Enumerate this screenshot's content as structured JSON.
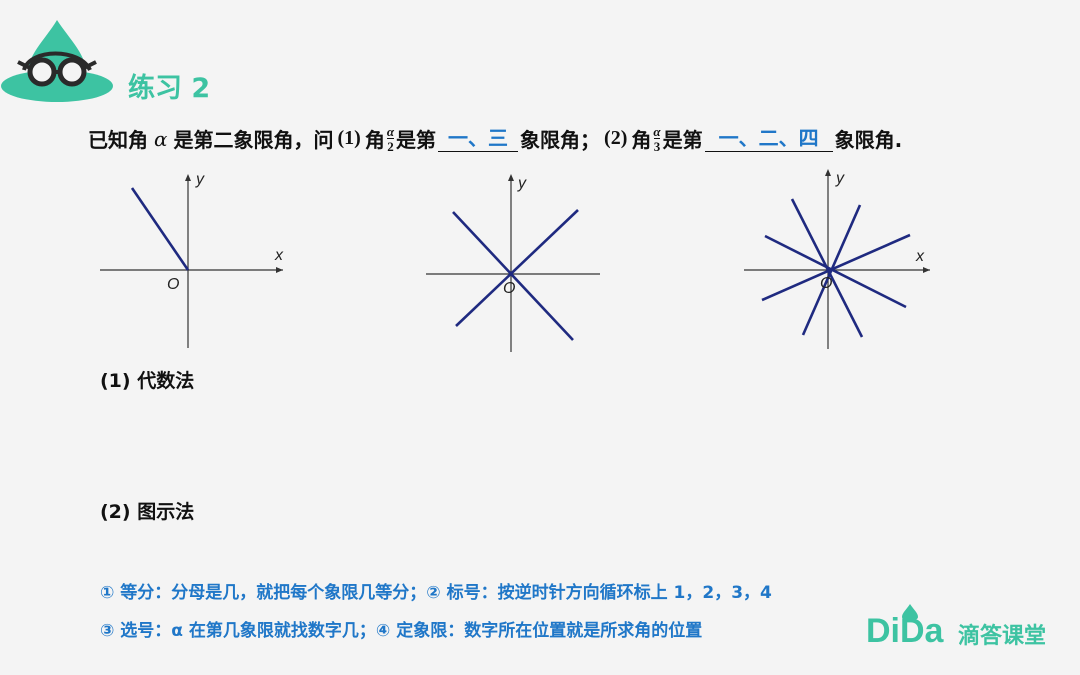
{
  "title": "练习 2",
  "question": {
    "p1": "已知角",
    "alpha": "α",
    "p2": "是第二象限角，问",
    "sub1": "(1)",
    "p3": "角",
    "frac1_num": "α",
    "frac1_den": "2",
    "p4": "是第",
    "answer1": "一、三",
    "p5": "象限角；",
    "sub2": "(2)",
    "p6": "角",
    "frac2_num": "α",
    "frac2_den": "3",
    "p7": "是第",
    "answer2": "一、二、四",
    "p8": "象限角."
  },
  "axes": {
    "x_label": "x",
    "y_label": "y",
    "origin_label": "O"
  },
  "methods": {
    "m1": "(1) 代数法",
    "m2": "(2) 图示法"
  },
  "notes": {
    "line1": "① 等分：分母是几，就把每个象限几等分；② 标号：按逆时针方向循环标上 1，2，3，4",
    "line2": "③ 选号：α 在第几象限就找数字几；④ 定象限：数字所在位置就是所求角的位置"
  },
  "brand": {
    "logo_text": "DiDa",
    "name": "滴答课堂"
  },
  "colors": {
    "accent": "#3dc3a2",
    "answer_blue": "#2077c8",
    "ray_navy": "#1f2a80"
  }
}
